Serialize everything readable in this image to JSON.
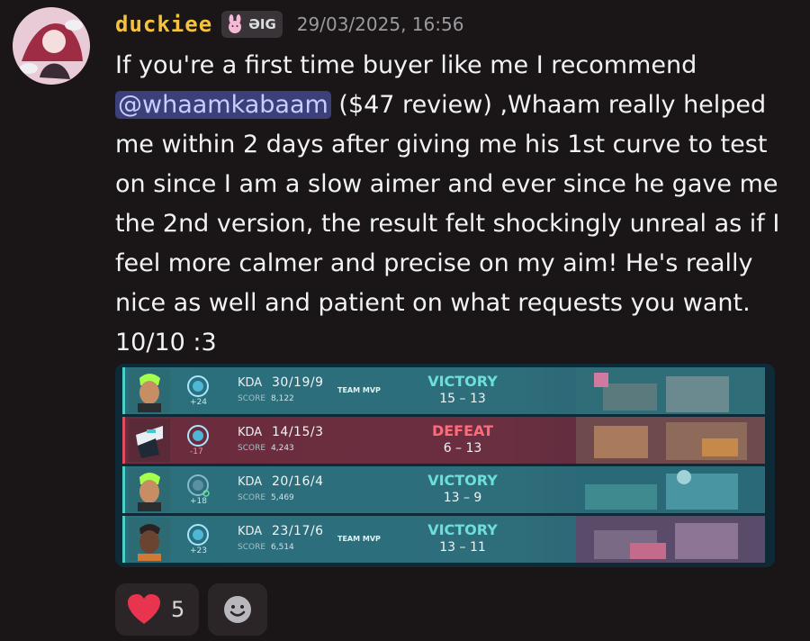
{
  "author": {
    "username": "duckiee",
    "tag_text": "ƏIG",
    "tag_icon": "bunny-icon",
    "timestamp": "29/03/2025, 16:56"
  },
  "message": {
    "line1": "If you're a first time buyer like me I recommend",
    "mention": "@whaamkabaam",
    "after_mention": " ($47 review) ,Whaam really helped me within 2 days after giving me his 1st curve to test on since I am a slow aimer and ever since he gave me the 2nd version, the result felt shockingly unreal as if I feel more calmer and precise on my aim! He's really nice as well and patient on what requests you want. 10/10 :3"
  },
  "matches": [
    {
      "rr": "+24",
      "kda_label": "KDA",
      "kda": "30/19/9",
      "score_label": "SCORE",
      "score": "8,122",
      "mvp": "TEAM MVP",
      "result": "VICTORY",
      "final": "15 – 13",
      "type": "victory"
    },
    {
      "rr": "-17",
      "kda_label": "KDA",
      "kda": "14/15/3",
      "score_label": "SCORE",
      "score": "4,243",
      "mvp": "",
      "result": "DEFEAT",
      "final": "6 – 13",
      "type": "defeat"
    },
    {
      "rr": "+18",
      "kda_label": "KDA",
      "kda": "20/16/4",
      "score_label": "SCORE",
      "score": "5,469",
      "mvp": "",
      "result": "VICTORY",
      "final": "13 – 9",
      "type": "victory"
    },
    {
      "rr": "+23",
      "kda_label": "KDA",
      "kda": "23/17/6",
      "score_label": "SCORE",
      "score": "6,514",
      "mvp": "TEAM MVP",
      "result": "VICTORY",
      "final": "13 – 11",
      "type": "victory"
    }
  ],
  "reactions": [
    {
      "icon": "heart-icon",
      "count": "5"
    }
  ],
  "add_reaction_icon": "smiley-icon",
  "colors": {
    "username": "#f5c33b",
    "victory": "#6ce0d8",
    "defeat": "#ff6b79",
    "mention_bg": "#3b3f7a"
  }
}
